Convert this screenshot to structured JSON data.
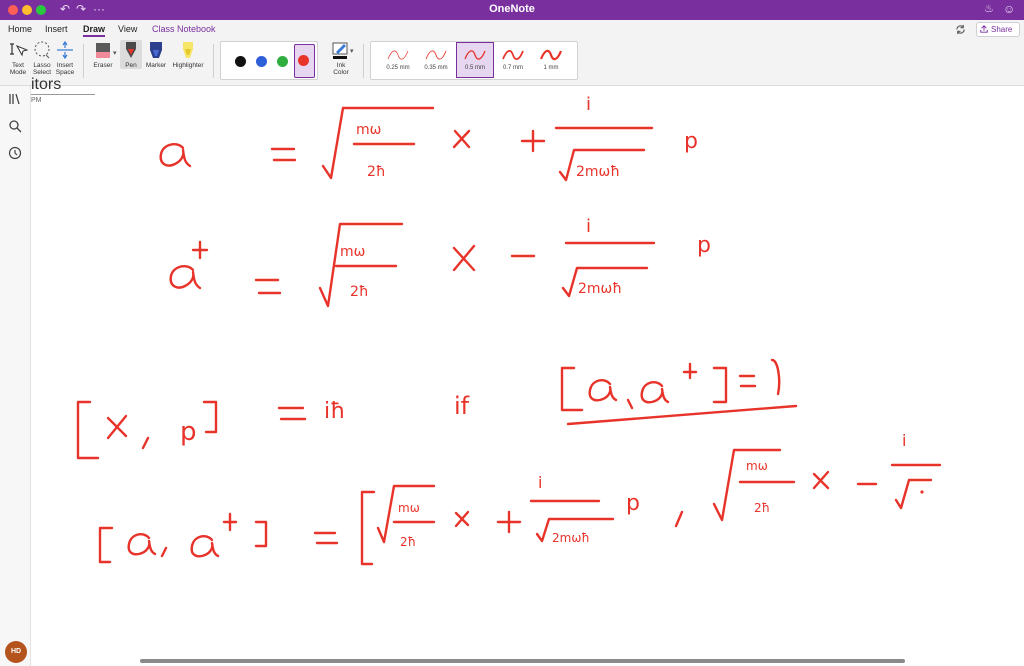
{
  "app": {
    "title": "OneNote"
  },
  "ribbon": {
    "tabs": [
      {
        "label": "Home"
      },
      {
        "label": "Insert"
      },
      {
        "label": "Draw"
      },
      {
        "label": "View"
      },
      {
        "label": "Class Notebook"
      }
    ],
    "active_tab": "Draw",
    "share_label": "Share"
  },
  "tools": {
    "text_mode": "Text Mode",
    "text_mode_l1": "Text",
    "text_mode_l2": "Mode",
    "lasso_l1": "Lasso",
    "lasso_l2": "Select",
    "insert_l1": "Insert",
    "insert_l2": "Space",
    "eraser": "Eraser",
    "pen": "Pen",
    "marker": "Marker",
    "highlighter": "Highlighter",
    "ink_l1": "Ink",
    "ink_l2": "Color"
  },
  "ink_colors": [
    "#111111",
    "#2f5fd8",
    "#2fae3f",
    "#e8332a"
  ],
  "selected_color": "#e8332a",
  "thickness": {
    "options": [
      "0.25 mm",
      "0.35 mm",
      "0.5 mm",
      "0.7 mm",
      "1 mm"
    ],
    "selected": "0.5 mm"
  },
  "page": {
    "title_fragment": "itors",
    "time_fragment": "PM"
  },
  "user": {
    "initials": "HD"
  },
  "colors": {
    "accent": "#7a2f9e",
    "ink": "#e8332a"
  }
}
